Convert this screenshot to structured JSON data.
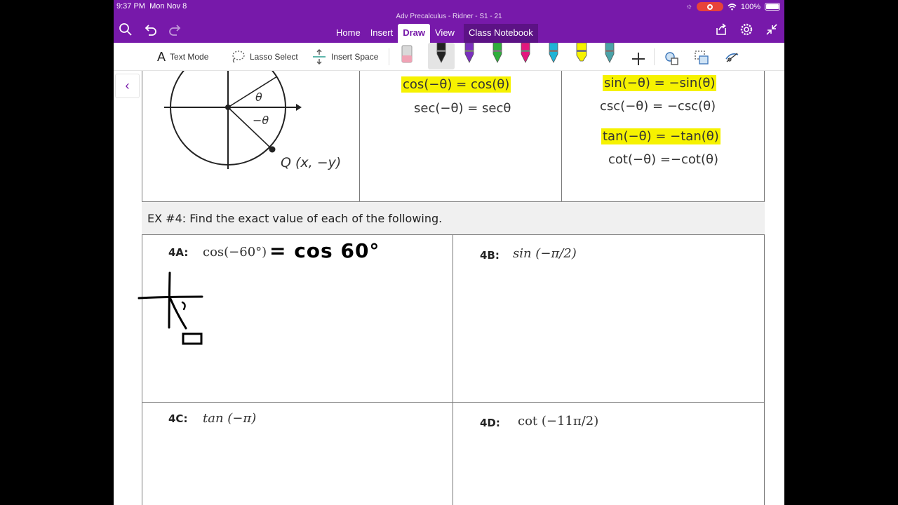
{
  "status_bar": {
    "time": "9:37 PM",
    "date": "Mon Nov 8",
    "battery": "100%",
    "battery_level": 1.0
  },
  "header": {
    "doc_title": "Adv Precalculus - Ridner - S1 - 21",
    "tabs": [
      "Home",
      "Insert",
      "Draw",
      "View",
      "Class Notebook"
    ],
    "active_tab": "Draw",
    "accent_color": "#7719aa"
  },
  "toolbar": {
    "text_mode": "Text Mode",
    "lasso_select": "Lasso Select",
    "insert_space": "Insert Space",
    "pens": [
      {
        "name": "pen-black",
        "color": "#222222"
      },
      {
        "name": "pen-purple",
        "color": "#7b2fbf"
      },
      {
        "name": "pen-green",
        "color": "#2fae3c"
      },
      {
        "name": "pen-pink",
        "color": "#e3177e"
      },
      {
        "name": "pen-cyan",
        "color": "#1fb3d6"
      },
      {
        "name": "highlighter-yellow",
        "color": "#f6f200"
      },
      {
        "name": "pen-teal",
        "color": "#4aa3a8"
      }
    ]
  },
  "unit_circle": {
    "theta": "θ",
    "neg_theta": "−θ",
    "point_q": "Q (x, −y)"
  },
  "identities": {
    "even": [
      "cos(−θ) = cos(θ)",
      "sec(−θ) = secθ"
    ],
    "odd": [
      "sin(−θ) = −sin(θ)",
      "csc(−θ) = −csc(θ)",
      "tan(−θ) = −tan(θ)",
      "cot(−θ) =−cot(θ)"
    ],
    "highlight_color": "#f6f200"
  },
  "example": {
    "title": "EX #4:  Find the exact value of each of the following.",
    "problems": [
      {
        "label": "4A:",
        "expr": "cos(−60°)",
        "ink_answer": "= cos 60°"
      },
      {
        "label": "4B:",
        "expr": "sin (−π/2)"
      },
      {
        "label": "4C:",
        "expr": "tan (−π)"
      },
      {
        "label": "4D:",
        "expr": "cot (−11π/2)"
      }
    ]
  }
}
